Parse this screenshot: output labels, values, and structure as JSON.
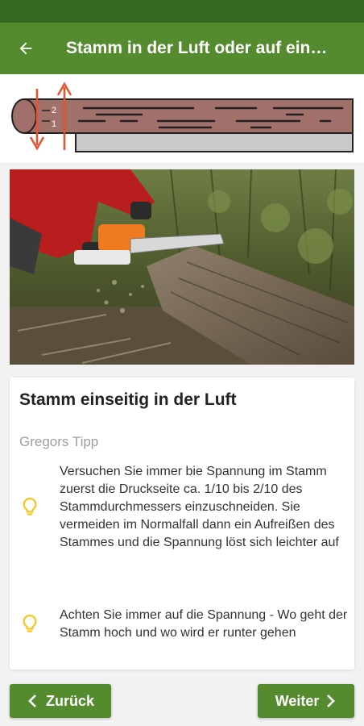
{
  "app_bar": {
    "title": "Stamm in der Luft oder auf einer Unterlage",
    "back_icon": "arrow-back-icon"
  },
  "diagram": {
    "labels": [
      "2",
      "1"
    ]
  },
  "photo": {
    "description_icon": "chainsaw-cutting-photo"
  },
  "card": {
    "title": "Stamm einseitig in der Luft",
    "subtitle": "Gregors Tipp",
    "tips": [
      {
        "icon": "lightbulb-icon",
        "text": "Versuchen Sie immer bie Spannung im Stamm zuerst die Druckseite ca. 1/10 bis 2/10 des Stammdurchmessers einzuschneiden. Sie vermeiden im Normalfall dann ein Aufreißen des Stammes und die Spannung löst sich leichter auf"
      },
      {
        "icon": "lightbulb-icon",
        "text": "Achten Sie immer auf die Spannung - Wo geht der Stamm hoch und wo wird er runter gehen"
      }
    ]
  },
  "nav": {
    "prev_label": "Zurück",
    "next_label": "Weiter"
  },
  "colors": {
    "primary": "#558b2f",
    "primary_dark": "#33691e",
    "log_brown": "#a1706a",
    "arrow_red": "#e8512f",
    "bulb_yellow": "#f5c518"
  }
}
